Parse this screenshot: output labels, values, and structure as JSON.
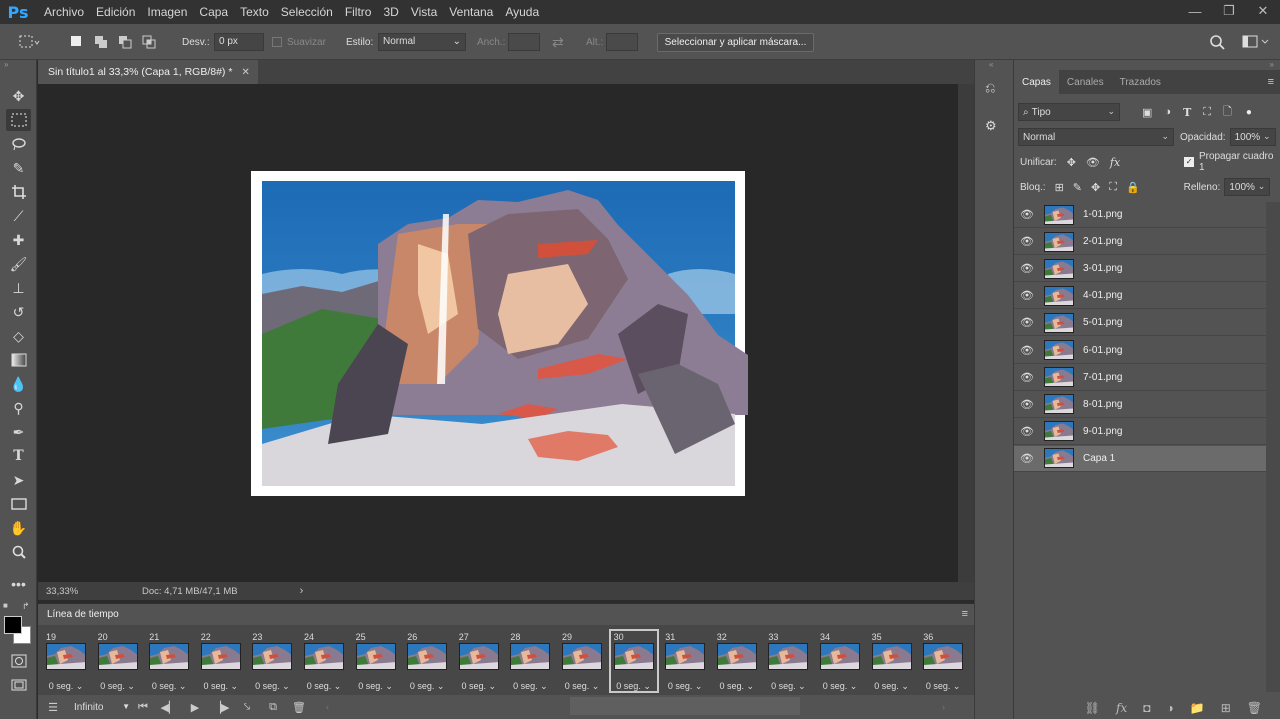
{
  "app": {
    "logo": "Ps"
  },
  "menubar": {
    "items": [
      "Archivo",
      "Edición",
      "Imagen",
      "Capa",
      "Texto",
      "Selección",
      "Filtro",
      "3D",
      "Vista",
      "Ventana",
      "Ayuda"
    ]
  },
  "window_controls": {
    "minimize": "—",
    "restore": "❐",
    "close": "✕"
  },
  "options": {
    "feather_label": "Desv.:",
    "feather_value": "0 px",
    "antialias_label": "Suavizar",
    "style_label": "Estilo:",
    "style_value": "Normal",
    "width_label": "Anch.:",
    "height_label": "Alt.:",
    "mask_button": "Seleccionar y aplicar máscara..."
  },
  "document": {
    "tab_title": "Sin título1 al 33,3% (Capa 1, RGB/8#) *",
    "zoom": "33,33%",
    "doc_info": "Doc: 4,71 MB/47,1 MB"
  },
  "timeline": {
    "title": "Línea de tiempo",
    "loop": "Infinito",
    "frames": [
      {
        "num": "19",
        "dur": "0 seg."
      },
      {
        "num": "20",
        "dur": "0 seg."
      },
      {
        "num": "21",
        "dur": "0 seg."
      },
      {
        "num": "22",
        "dur": "0 seg."
      },
      {
        "num": "23",
        "dur": "0 seg."
      },
      {
        "num": "24",
        "dur": "0 seg."
      },
      {
        "num": "25",
        "dur": "0 seg."
      },
      {
        "num": "26",
        "dur": "0 seg."
      },
      {
        "num": "27",
        "dur": "0 seg."
      },
      {
        "num": "28",
        "dur": "0 seg."
      },
      {
        "num": "29",
        "dur": "0 seg."
      },
      {
        "num": "30",
        "dur": "0 seg."
      },
      {
        "num": "31",
        "dur": "0 seg."
      },
      {
        "num": "32",
        "dur": "0 seg."
      },
      {
        "num": "33",
        "dur": "0 seg."
      },
      {
        "num": "34",
        "dur": "0 seg."
      },
      {
        "num": "35",
        "dur": "0 seg."
      },
      {
        "num": "36",
        "dur": "0 seg."
      }
    ],
    "selected_frame": "30"
  },
  "layers_panel": {
    "tabs": [
      "Capas",
      "Canales",
      "Trazados"
    ],
    "filter_label": "Tipo",
    "blend_mode": "Normal",
    "opacity_label": "Opacidad:",
    "opacity_value": "100%",
    "unify_label": "Unificar:",
    "propagate_label": "Propagar cuadro 1",
    "lock_label": "Bloq.:",
    "fill_label": "Relleno:",
    "fill_value": "100%",
    "layers": [
      {
        "name": "1-01.png"
      },
      {
        "name": "2-01.png"
      },
      {
        "name": "3-01.png"
      },
      {
        "name": "4-01.png"
      },
      {
        "name": "5-01.png"
      },
      {
        "name": "6-01.png"
      },
      {
        "name": "7-01.png"
      },
      {
        "name": "8-01.png"
      },
      {
        "name": "9-01.png"
      },
      {
        "name": "Capa 1"
      }
    ],
    "selected_layer": "Capa 1"
  },
  "colors": {
    "accent": "#31a8ff",
    "panel": "#535353",
    "canvas_bg": "#282828",
    "sky": "#2a74b8"
  }
}
